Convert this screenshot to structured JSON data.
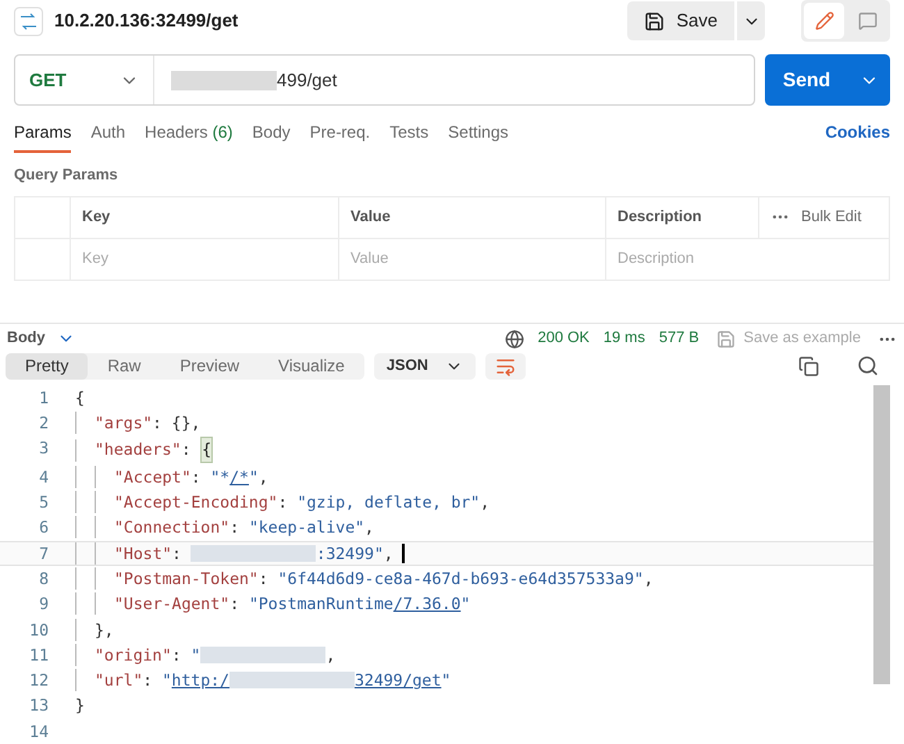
{
  "header": {
    "title": "10.2.20.136:32499/get",
    "save": "Save"
  },
  "request": {
    "method": "GET",
    "url": "499/get",
    "send": "Send"
  },
  "tabs": [
    {
      "label": "Params",
      "selected": true
    },
    {
      "label": "Auth",
      "selected": false
    },
    {
      "label": "Headers",
      "count": "(6)",
      "selected": false
    },
    {
      "label": "Body",
      "selected": false
    },
    {
      "label": "Pre-req.",
      "selected": false
    },
    {
      "label": "Tests",
      "selected": false
    },
    {
      "label": "Settings",
      "selected": false
    }
  ],
  "cookies": "Cookies",
  "query_params": {
    "title": "Query Params",
    "columns": [
      "Key",
      "Value",
      "Description"
    ],
    "bulk_edit": "Bulk Edit",
    "placeholders": [
      "Key",
      "Value",
      "Description"
    ]
  },
  "response": {
    "section": "Body",
    "status": "200 OK",
    "time": "19 ms",
    "size": "577 B",
    "save_example": "Save as example",
    "view_tabs": [
      {
        "label": "Pretty",
        "selected": true
      },
      {
        "label": "Raw",
        "selected": false
      },
      {
        "label": "Preview",
        "selected": false
      },
      {
        "label": "Visualize",
        "selected": false
      }
    ],
    "format": "JSON"
  },
  "code": [
    {
      "n": "1",
      "active": false,
      "kind": "root",
      "tokens": [
        {
          "kind": "p",
          "t": "{"
        }
      ]
    },
    {
      "n": "2",
      "active": false,
      "kind": "member",
      "tokens": [
        {
          "kind": "k",
          "t": "\"args\""
        },
        {
          "kind": "p",
          "t": ": {},"
        }
      ]
    },
    {
      "n": "3",
      "active": false,
      "kind": "member",
      "tokens": [
        {
          "kind": "k",
          "t": "\"headers\""
        },
        {
          "kind": "p",
          "t": ": "
        },
        {
          "kind": "m",
          "t": "{"
        }
      ]
    },
    {
      "n": "4",
      "active": false,
      "kind": "nested",
      "tokens": [
        {
          "kind": "k",
          "t": "\"Accept\""
        },
        {
          "kind": "p",
          "t": ": "
        },
        {
          "kind": "s",
          "t": "\"*"
        },
        {
          "kind": "u",
          "t": "/*"
        },
        {
          "kind": "s",
          "t": "\""
        },
        {
          "kind": "p",
          "t": ","
        }
      ]
    },
    {
      "n": "5",
      "active": false,
      "kind": "nested",
      "tokens": [
        {
          "kind": "k",
          "t": "\"Accept-Encoding\""
        },
        {
          "kind": "p",
          "t": ": "
        },
        {
          "kind": "s",
          "t": "\"gzip, deflate, br\""
        },
        {
          "kind": "p",
          "t": ","
        }
      ]
    },
    {
      "n": "6",
      "active": false,
      "kind": "nested",
      "tokens": [
        {
          "kind": "k",
          "t": "\"Connection\""
        },
        {
          "kind": "p",
          "t": ": "
        },
        {
          "kind": "s",
          "t": "\"keep-alive\""
        },
        {
          "kind": "p",
          "t": ","
        }
      ]
    },
    {
      "n": "7",
      "active": true,
      "kind": "nested",
      "tokens": [
        {
          "kind": "k",
          "t": "\"Host\""
        },
        {
          "kind": "p",
          "t": ": "
        },
        {
          "kind": "r"
        },
        {
          "kind": "s",
          "t": ":32499\""
        },
        {
          "kind": "p",
          "t": ","
        }
      ]
    },
    {
      "n": "8",
      "active": false,
      "kind": "nested",
      "tokens": [
        {
          "kind": "k",
          "t": "\"Postman-Token\""
        },
        {
          "kind": "p",
          "t": ": "
        },
        {
          "kind": "s",
          "t": "\"6f44d6d9-ce8a-467d-b693-e64d357533a9\""
        },
        {
          "kind": "p",
          "t": ","
        }
      ]
    },
    {
      "n": "9",
      "active": false,
      "kind": "nested",
      "tokens": [
        {
          "kind": "k",
          "t": "\"User-Agent\""
        },
        {
          "kind": "p",
          "t": ": "
        },
        {
          "kind": "s",
          "t": "\"PostmanRuntime"
        },
        {
          "kind": "u",
          "t": "/7.36.0"
        },
        {
          "kind": "s",
          "t": "\""
        }
      ]
    },
    {
      "n": "10",
      "active": false,
      "kind": "member",
      "tokens": [
        {
          "kind": "p",
          "t": "},"
        }
      ]
    },
    {
      "n": "11",
      "active": false,
      "kind": "member",
      "tokens": [
        {
          "kind": "k",
          "t": "\"origin\""
        },
        {
          "kind": "p",
          "t": ": "
        },
        {
          "kind": "s",
          "t": "\""
        },
        {
          "kind": "r"
        },
        {
          "kind": "p",
          "t": ","
        }
      ]
    },
    {
      "n": "12",
      "active": false,
      "kind": "member",
      "tokens": [
        {
          "kind": "k",
          "t": "\"url\""
        },
        {
          "kind": "p",
          "t": ": "
        },
        {
          "kind": "s",
          "t": "\""
        },
        {
          "kind": "u",
          "t": "http:/"
        },
        {
          "kind": "r"
        },
        {
          "kind": "u",
          "t": "32499/get"
        },
        {
          "kind": "s",
          "t": "\""
        }
      ]
    },
    {
      "n": "13",
      "active": false,
      "kind": "root",
      "tokens": [
        {
          "kind": "p",
          "t": "}"
        }
      ]
    },
    {
      "n": "14",
      "active": false,
      "kind": "root"
    }
  ]
}
